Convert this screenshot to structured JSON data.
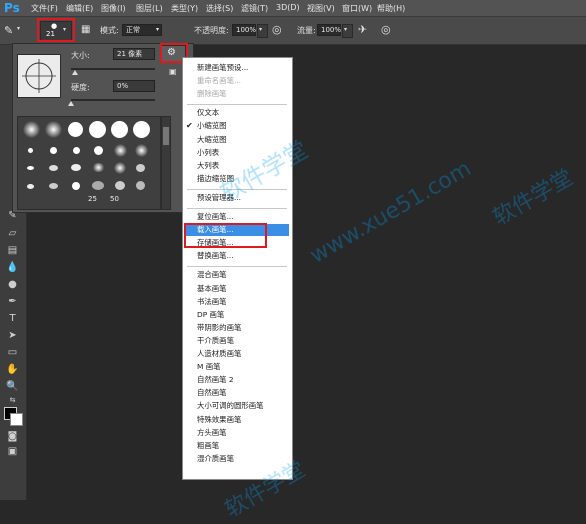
{
  "menubar": {
    "logo": "Ps",
    "items": [
      "文件(F)",
      "编辑(E)",
      "图像(I)",
      "图层(L)",
      "类型(Y)",
      "选择(S)",
      "滤镜(T)",
      "3D(D)",
      "视图(V)",
      "窗口(W)",
      "帮助(H)"
    ]
  },
  "options": {
    "brush_size": "21",
    "mode_label": "模式:",
    "mode_value": "正常",
    "opacity_label": "不透明度:",
    "opacity_value": "100%",
    "flow_label": "流量:",
    "flow_value": "100%"
  },
  "brush_panel": {
    "size_label": "大小:",
    "size_value": "21 像素",
    "hardness_label": "硬度:",
    "hardness_value": "0%",
    "size_slider_fraction": 0.05,
    "hardness_slider_fraction": 0.0,
    "preset_sizes": [
      "25",
      "50"
    ]
  },
  "context_menu": {
    "items": [
      "新建画笔预设...",
      "重命名画笔...",
      "删除画笔",
      "仅文本",
      "小缩览图",
      "大缩览图",
      "小列表",
      "大列表",
      "描边缩览图",
      "预设管理器...",
      "复位画笔...",
      "载入画笔...",
      "存储画笔...",
      "替换画笔...",
      "混合画笔",
      "基本画笔",
      "书法画笔",
      "DP 画笔",
      "带阴影的画笔",
      "干介质画笔",
      "人造材质画笔",
      "M 画笔",
      "自然画笔 2",
      "自然画笔",
      "大小可调的圆形画笔",
      "特殊效果画笔",
      "方头画笔",
      "粗画笔",
      "湿介质画笔"
    ],
    "checked_item": "小缩览图",
    "highlighted_item": "载入画笔...",
    "disabled_items": [
      "重命名画笔...",
      "删除画笔"
    ]
  },
  "watermark": {
    "text_cn": "软件学堂",
    "text_url": "www.xue51.com"
  },
  "colors": {
    "accent": "#3a8ee6",
    "annotation_red": "#e0191e",
    "ps_blue": "#31a8ff"
  }
}
